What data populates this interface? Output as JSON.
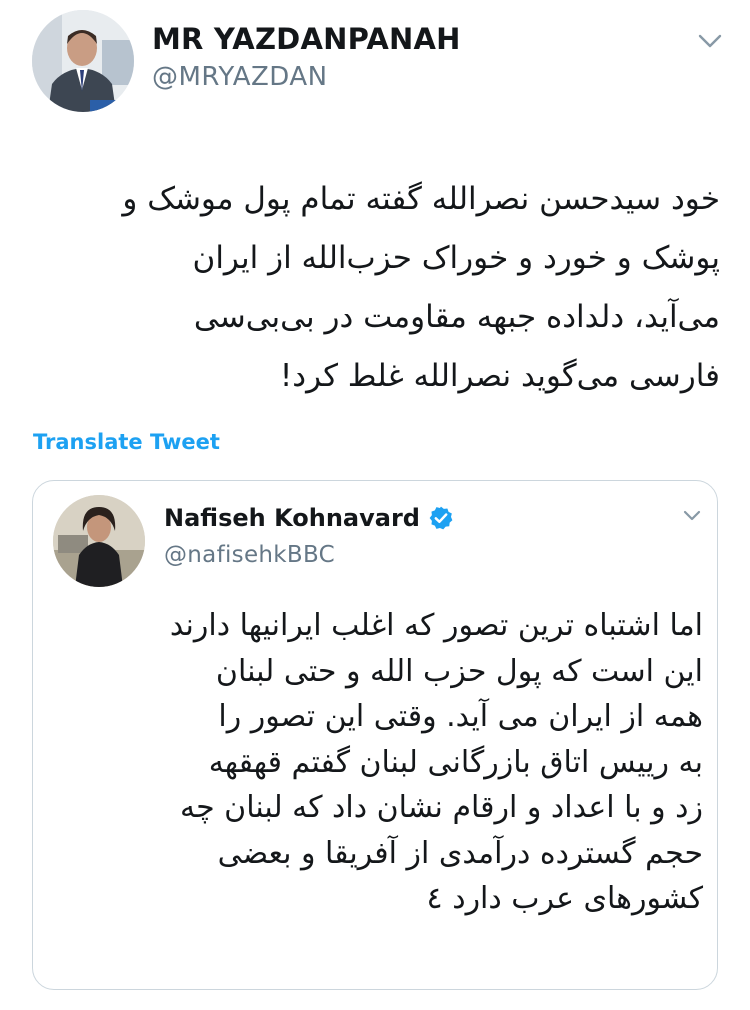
{
  "tweet": {
    "author_name": "MR YAZDANPANAH",
    "author_handle": "@MRYAZDAN",
    "text_lines": [
      "خود سیدحسن نصرالله گفته تمام پول موشک و",
      "پوشک و خورد و خوراک حزب‌الله از ایران",
      "می‌آید، دلداده جبهه مقاومت در بی‌بی‌سی",
      "فارسی می‌گوید نصرالله غلط کرد!"
    ],
    "translate_label": "Translate Tweet",
    "menu_icon": "chevron-down-icon"
  },
  "quoted_tweet": {
    "author_name": "Nafiseh Kohnavard",
    "author_handle": "@nafisehkBBC",
    "verified": true,
    "verified_icon": "verified-badge-icon",
    "menu_icon": "chevron-down-icon",
    "text_lines": [
      "اما اشتباه ترین تصور که اغلب ایرانیها دارند",
      "این است که پول حزب الله و حتی لبنان",
      "همه از ایران می آید. وقتی این تصور را",
      "به رییس اتاق بازرگانی لبنان گفتم قهقهه",
      "زد و با اعداد و ارقام نشان داد که لبنان چه",
      "حجم گسترده درآمدی از آفریقا و بعضی",
      "کشورهای عرب دارد ٤"
    ]
  },
  "colors": {
    "link_blue": "#1da1f2",
    "secondary_text": "#657786",
    "border": "#ccd6dd",
    "primary_text": "#14171a"
  }
}
